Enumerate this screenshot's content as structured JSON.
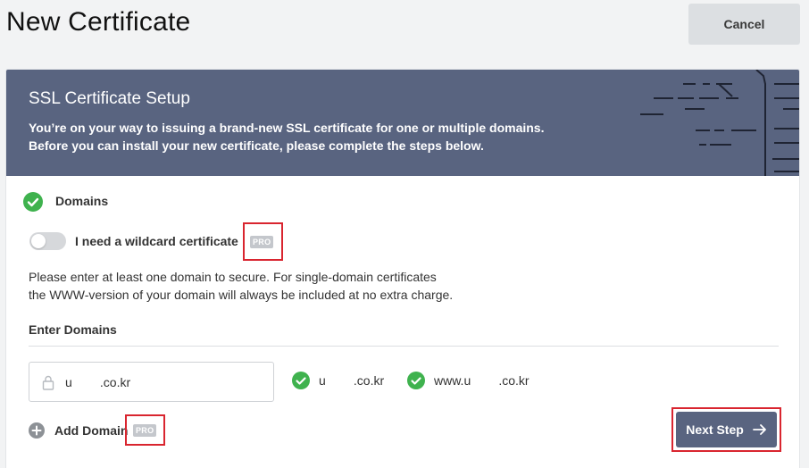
{
  "page": {
    "title": "New Certificate",
    "cancel_label": "Cancel"
  },
  "header": {
    "title": "SSL Certificate Setup",
    "description_line1": "You’re on your way to issuing a brand-new SSL certificate for one or multiple domains.",
    "description_line2": "Before you can install your new certificate, please complete the steps below."
  },
  "step": {
    "label": "Domains",
    "status": "complete"
  },
  "wildcard": {
    "label": "I need a wildcard certificate",
    "enabled": false,
    "badge": "PRO"
  },
  "info": {
    "line1": "Please enter at least one domain to secure. For single-domain certificates",
    "line2": "the WWW-version of your domain will always be included at no extra charge."
  },
  "domains": {
    "section_title": "Enter Domains",
    "input_value": "u        .co.kr",
    "results": [
      "u        .co.kr",
      "www.u        .co.kr"
    ]
  },
  "add_domain": {
    "label": "Add Domain",
    "badge": "PRO"
  },
  "next": {
    "label": "Next Step"
  },
  "colors": {
    "header_bg": "#596480",
    "success": "#3fb24e",
    "highlight": "#d9252f",
    "badge": "#c4c7cc"
  }
}
